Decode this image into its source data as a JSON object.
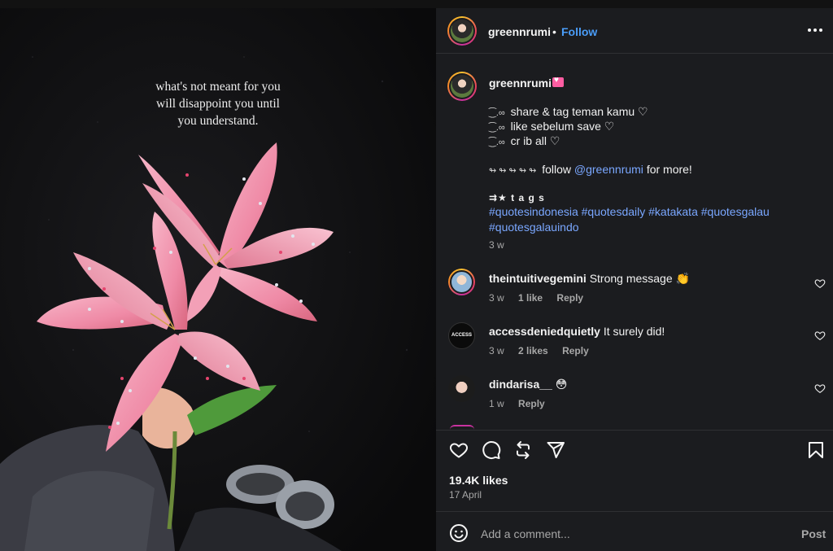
{
  "media": {
    "quote_lines": [
      "what's not meant for you",
      "will disappoint you until",
      "you understand."
    ]
  },
  "header": {
    "username": "greennrumi",
    "separator": "•",
    "follow_label": "Follow",
    "more_icon": "more-horizontal-icon"
  },
  "caption": {
    "username": "greennrumi",
    "emoji_icon": "pink-heart-letter-icon",
    "lines": [
      {
        "deco": "⁐.∞",
        "text": "share & tag teman kamu ♡"
      },
      {
        "deco": "⁐.∞",
        "text": "like sebelum save ♡"
      },
      {
        "deco": "⁐.∞",
        "text": "cr ib all ♡"
      }
    ],
    "follow_line": {
      "deco": "↬ ↬ ↬ ↬ ↬",
      "prefix": "follow",
      "mention": "@greennrumi",
      "suffix": "for more!"
    },
    "tags_title": "⇉★ t a g s",
    "hashtags": "#quotesindonesia #quotesdaily #katakata #quotesgalau #quotesgalauindo",
    "ago": "3 w"
  },
  "comments": [
    {
      "username": "theintuitivegemini",
      "text": "Strong message 👏",
      "ago": "3 w",
      "likes": "1 like",
      "reply": "Reply"
    },
    {
      "username": "accessdeniedquietly",
      "text": "It surely did!",
      "ago": "3 w",
      "likes": "2 likes",
      "reply": "Reply",
      "avatar_text": "ACCESS"
    },
    {
      "username": "dindarisa__",
      "text": "😳",
      "ago": "1 w",
      "reply": "Reply"
    }
  ],
  "actions": {
    "icons": [
      "heart-icon",
      "comment-icon",
      "repost-icon",
      "share-icon",
      "bookmark-icon"
    ]
  },
  "stats": {
    "likes": "19.4K likes",
    "date": "17 April"
  },
  "composer": {
    "placeholder": "Add a comment...",
    "post_label": "Post"
  },
  "colors": {
    "panel_bg": "#1b1c1f",
    "link_blue": "#4a9df8",
    "hashtag_blue": "#7aa7ff",
    "muted": "#a8a8a8"
  }
}
